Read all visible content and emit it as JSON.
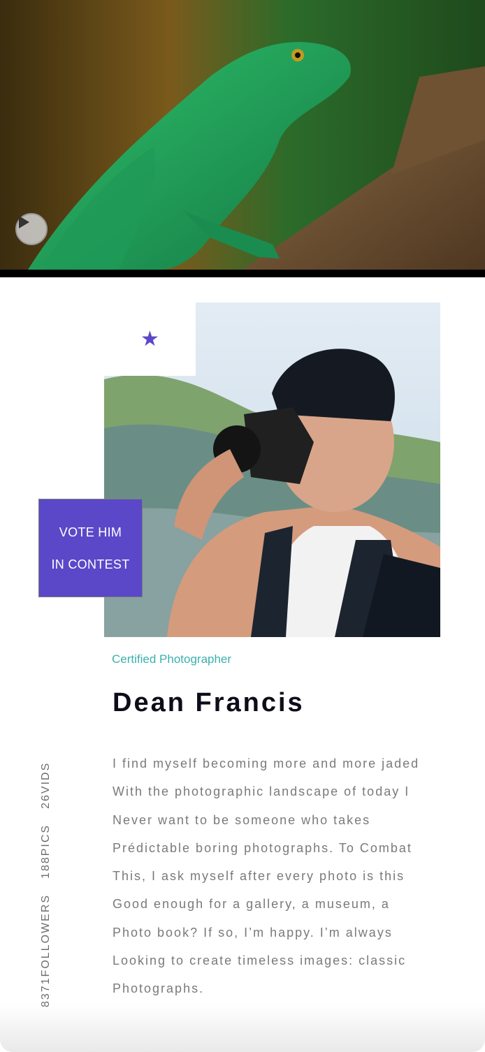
{
  "hero": {
    "image_subject": "green basilisk lizard on branch",
    "play_icon": "play-icon"
  },
  "profile": {
    "badge_icon": "star-icon",
    "accent_color": "#5a48c8",
    "vote_button": {
      "line1": "VOTE HIM",
      "line2": "IN CONTEST"
    },
    "certified_label": "Certified Photographer",
    "certified_color": "#3bb0ad",
    "name": "Dean Francis",
    "bio_lines": [
      "I find myself becoming more and more jaded",
      "With the photographic landscape of today I",
      "Never want to be someone who takes",
      "Prédictable boring photographs. To Combat",
      "This, I ask myself after every photo is this",
      "Good enough for a gallery, a museum, a",
      "Photo book? If so, I’m happy. I’m always",
      "Looking to create timeless images: classic",
      "Photographs."
    ]
  },
  "stats": {
    "followers": "8371FOLLOWERS",
    "pics": "188PICS",
    "vids": "26VIDS"
  }
}
